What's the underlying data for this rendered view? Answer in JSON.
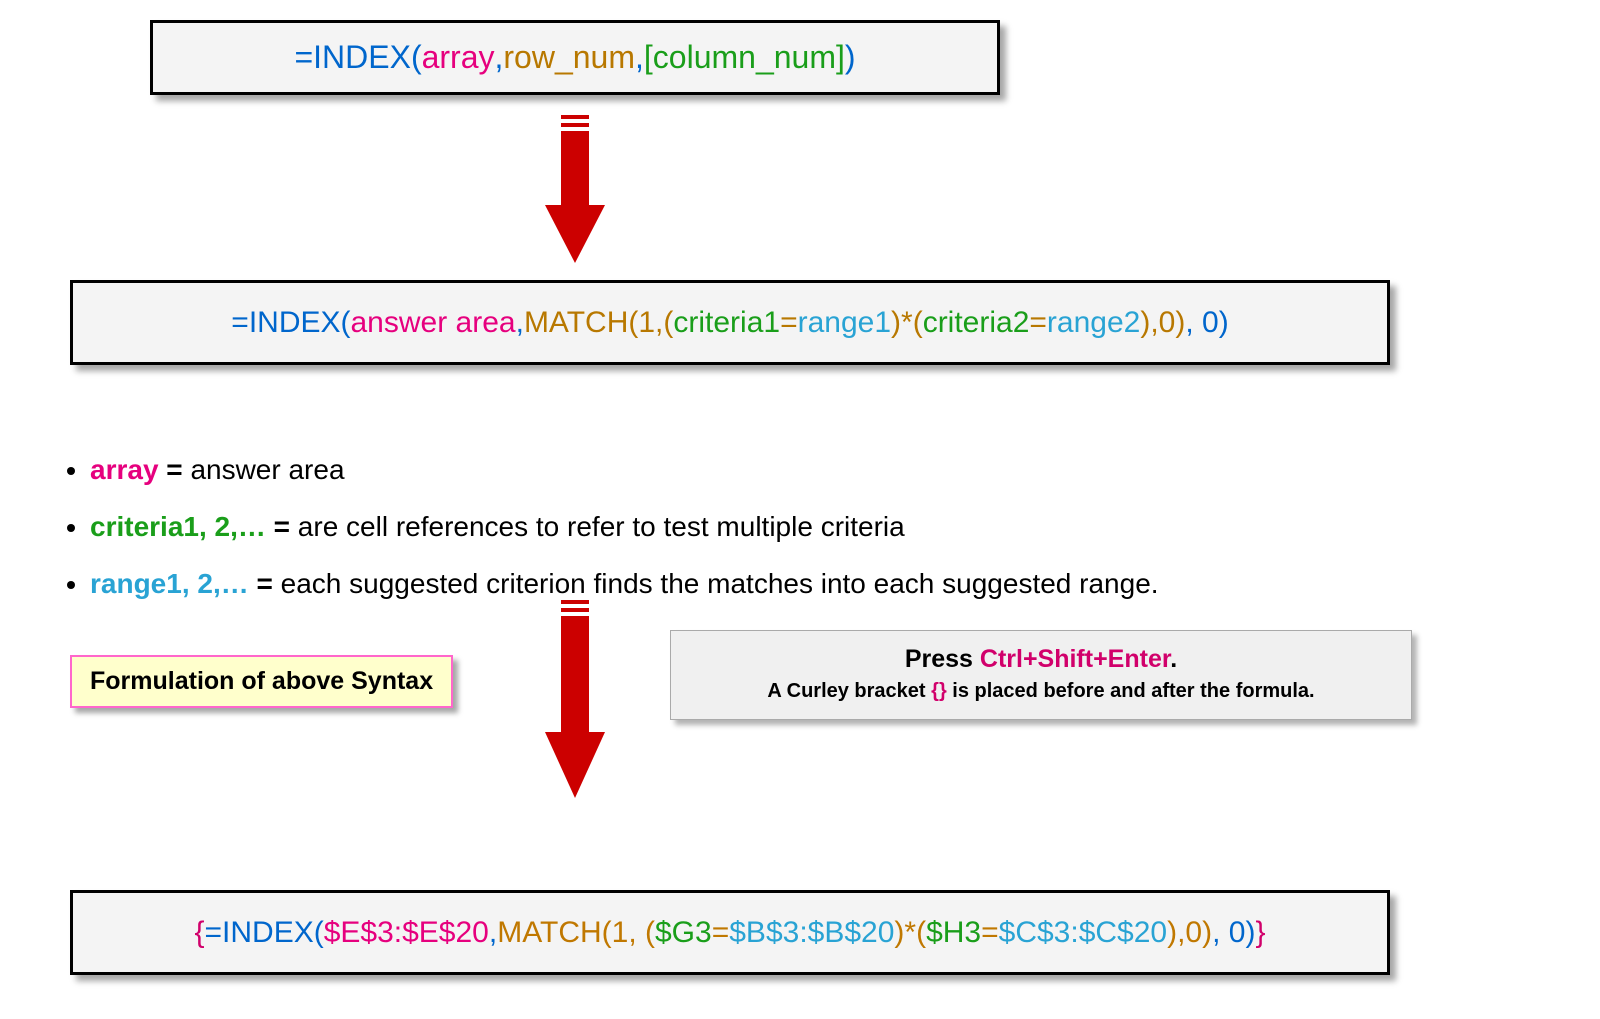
{
  "box1": {
    "t1": "=INDEX( ",
    "t2": "array",
    "t3": ", ",
    "t4": "row_num",
    "t5": ", ",
    "t6": "[column_num]",
    "t7": " )"
  },
  "box2": {
    "t1": "=INDEX(",
    "t2": "answer area",
    "t3": ", ",
    "t4": "MATCH",
    "t5": "(1,(",
    "t6": "criteria1",
    "t7": "=",
    "t8": "range1",
    "t9": ")*( ",
    "t10": "criteria2",
    "t11": "=",
    "t12": "range2",
    "t13": "),0)",
    "t14": ", 0)"
  },
  "bullets": {
    "b1_term": "array",
    "b1_eq": " = ",
    "b1_rest": "answer area",
    "b2_term": "criteria1, 2,…",
    "b2_eq": " = ",
    "b2_rest": "are cell references to refer to test multiple criteria",
    "b3_term": "range1, 2,…",
    "b3_eq": " = ",
    "b3_rest": "each suggested criterion finds the matches into each suggested range."
  },
  "label": "Formulation of above Syntax",
  "info": {
    "line1_a": "Press ",
    "line1_b": "Ctrl+Shift+Enter",
    "line1_c": ".",
    "line2_a": "A Curley bracket ",
    "line2_b": "{}",
    "line2_c": " is placed before and after the formula."
  },
  "box3": {
    "t1": "{",
    "t2": "=INDEX(",
    "t3": "$E$3:$E$20",
    "t4": ", ",
    "t5": "MATCH",
    "t6": "(1, (",
    "t7": "$G3",
    "t8": "=",
    "t9": "$B$3:$B$20",
    "t10": ")*(",
    "t11": "$H3",
    "t12": "=",
    "t13": "$C$3:$C$20",
    "t14": "),0)",
    "t15": ", 0)",
    "t16": "}"
  }
}
